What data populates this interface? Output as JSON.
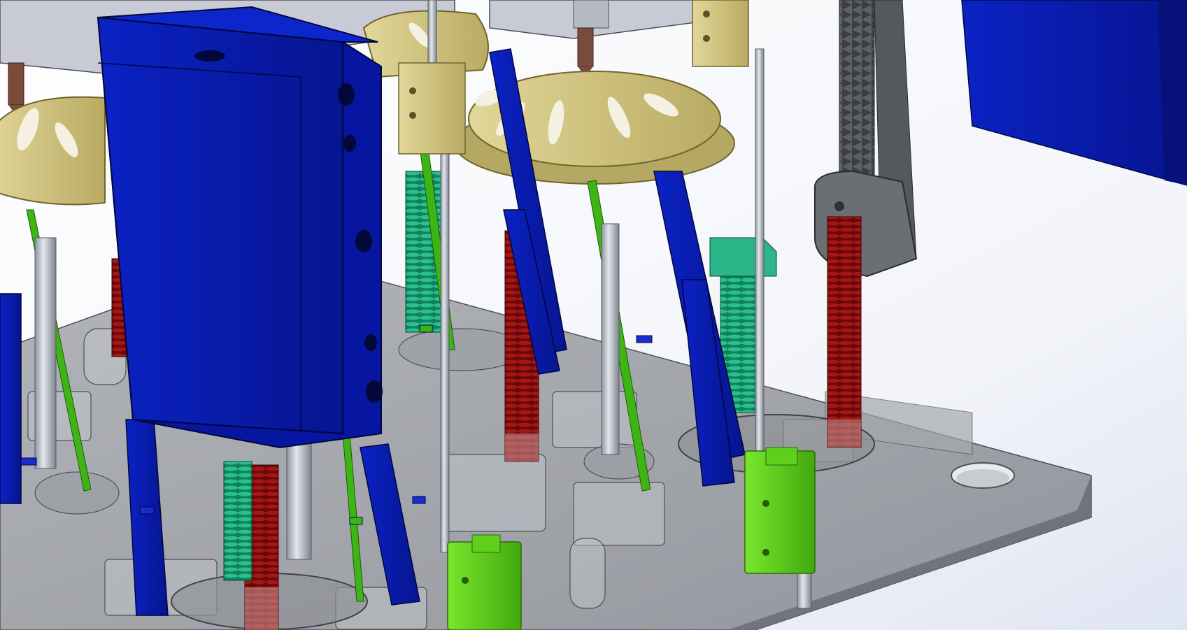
{
  "scene": {
    "description_free": true,
    "palette": {
      "background_top": "#ffffff",
      "background_glow": "#dde3f0",
      "base_plate": "#8c8f94",
      "base_plate_edge": "#5e6166",
      "carriage_blue": "#0a1fb0",
      "carriage_blue_dark": "#061480",
      "tray_tan": "#d8cf8e",
      "tray_tan_dark": "#a89c55",
      "bushing_tan": "#cdbf7a",
      "slide_green": "#5fd11a",
      "slide_green_dark": "#3a9a0c",
      "spring_red": "#8a0f0f",
      "spring_red_dark": "#5a0606",
      "spring_teal": "#1fa67a",
      "rod_steel": "#a7adb8",
      "rack_grey": "#6b6e73",
      "rack_dark": "#3e4045",
      "spindle_brown": "#7a4a3a"
    },
    "icons": [
      "base-plate",
      "blue-carriage",
      "tan-tray",
      "green-slide-block",
      "red-spring",
      "teal-spring",
      "steel-rod",
      "gear-rack",
      "blue-panel"
    ]
  }
}
